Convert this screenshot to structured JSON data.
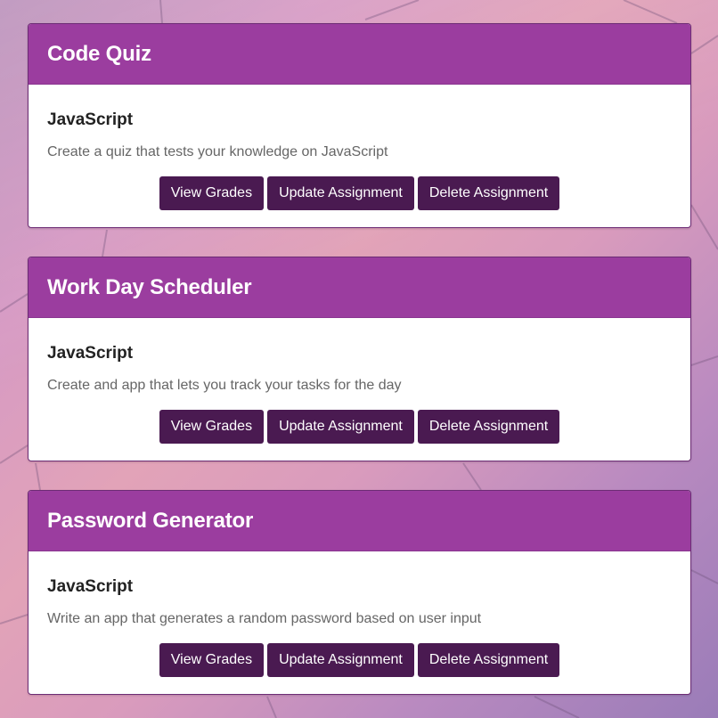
{
  "assignments": [
    {
      "title": "Code Quiz",
      "subject": "JavaScript",
      "description": "Create a quiz that tests your knowledge on JavaScript",
      "buttons": {
        "view": "View Grades",
        "update": "Update Assignment",
        "delete": "Delete Assignment"
      }
    },
    {
      "title": "Work Day Scheduler",
      "subject": "JavaScript",
      "description": "Create and app that lets you track your tasks for the day",
      "buttons": {
        "view": "View Grades",
        "update": "Update Assignment",
        "delete": "Delete Assignment"
      }
    },
    {
      "title": "Password Generator",
      "subject": "JavaScript",
      "description": "Write an app that generates a random password based on user input",
      "buttons": {
        "view": "View Grades",
        "update": "Update Assignment",
        "delete": "Delete Assignment"
      }
    }
  ],
  "colors": {
    "card_header": "#9b3d9f",
    "button": "#4a1a51",
    "card_border": "#6d2c75"
  }
}
